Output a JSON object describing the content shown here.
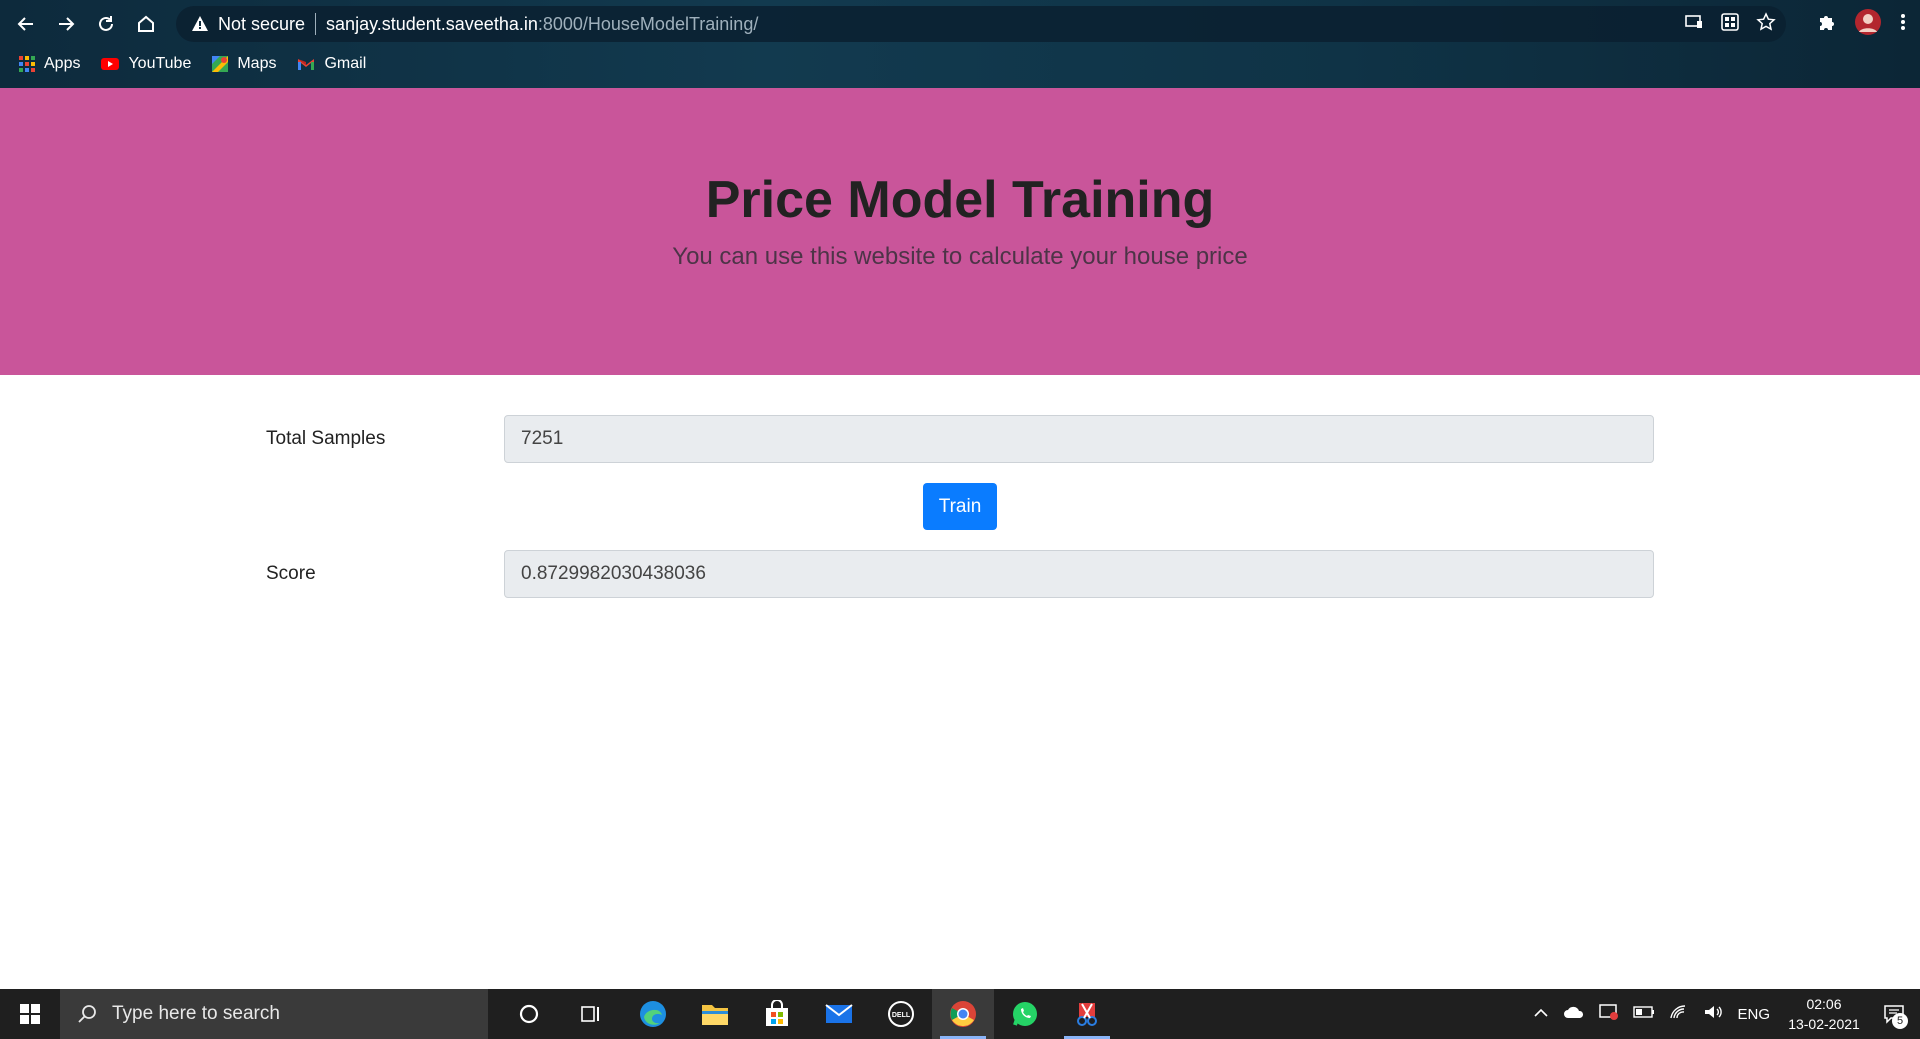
{
  "browser": {
    "security_label": "Not secure",
    "url_host": "sanjay.student.saveetha.in",
    "url_path": ":8000/HouseModelTraining/",
    "bookmarks": [
      {
        "label": "Apps",
        "icon": "apps-grid-icon"
      },
      {
        "label": "YouTube",
        "icon": "youtube-icon"
      },
      {
        "label": "Maps",
        "icon": "maps-icon"
      },
      {
        "label": "Gmail",
        "icon": "gmail-icon"
      }
    ]
  },
  "page": {
    "title": "Price Model Training",
    "subtitle": "You can use this website to calculate your house price",
    "hero_color": "#c9559a",
    "samples_label": "Total Samples",
    "samples_value": "7251",
    "train_label": "Train",
    "score_label": "Score",
    "score_value": "0.8729982030438036"
  },
  "taskbar": {
    "search_placeholder": "Type here to search",
    "language": "ENG",
    "time": "02:06",
    "date": "13-02-2021",
    "notification_count": "5"
  }
}
